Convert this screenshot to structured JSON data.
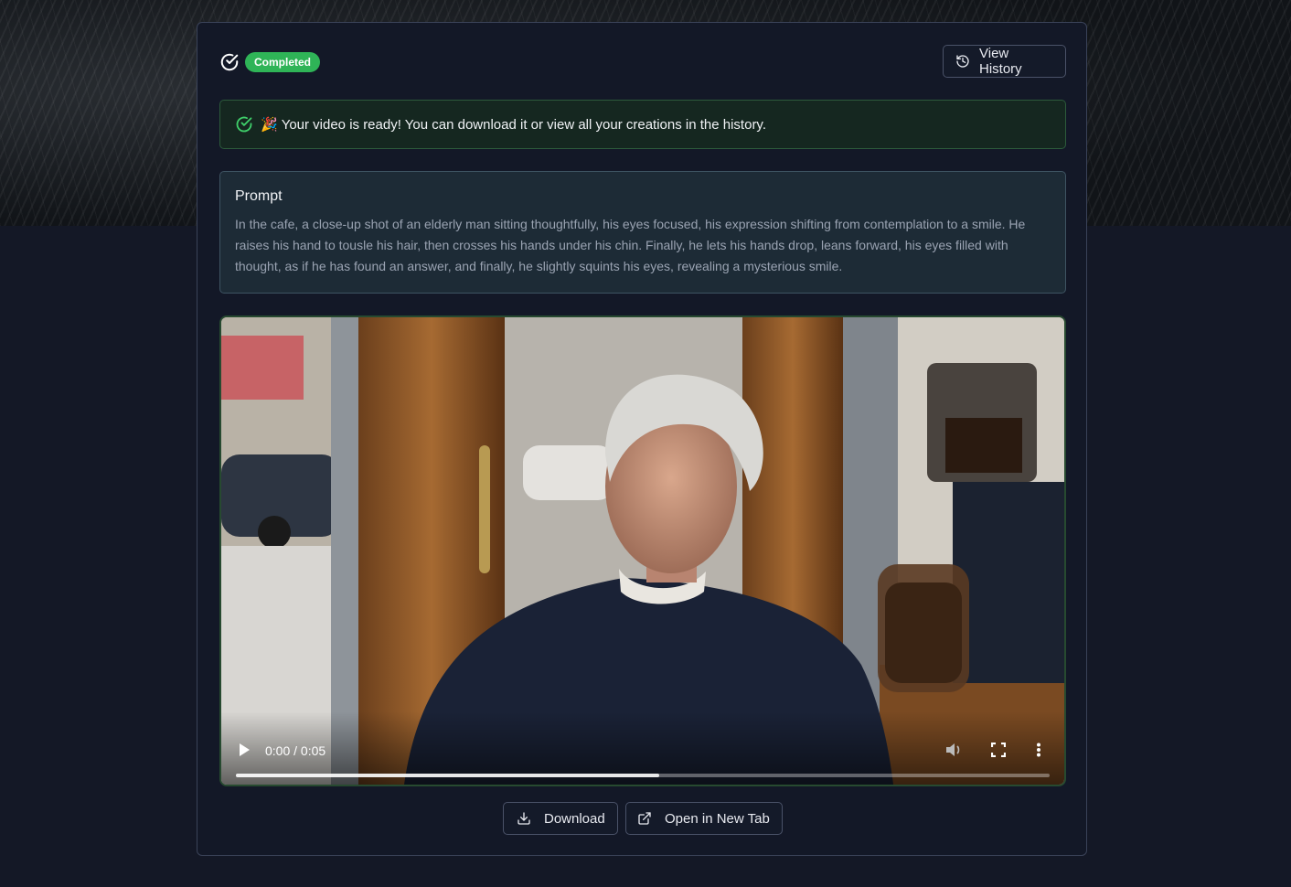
{
  "status": {
    "badge": "Completed",
    "icon": "check-circle-icon",
    "color": "#2fb457"
  },
  "header": {
    "history_label": "View History",
    "history_icon": "history-icon"
  },
  "alert": {
    "icon": "check-circle-icon",
    "emoji": "🎉",
    "message": "Your video is ready! You can download it or view all your creations in the history."
  },
  "prompt": {
    "title": "Prompt",
    "text": "In the cafe, a close-up shot of an elderly man sitting thoughtfully, his eyes focused, his expression shifting from contemplation to a smile. He raises his hand to tousle his hair, then crosses his hands under his chin. Finally, he lets his hands drop, leans forward, his eyes filled with thought, as if he has found an answer, and finally, he slightly squints his eyes, revealing a mysterious smile."
  },
  "video": {
    "time": "0:00 / 0:05",
    "progress": 0.52,
    "icons": [
      "play-icon",
      "volume-icon",
      "fullscreen-icon",
      "more-options-icon"
    ]
  },
  "actions": {
    "download_label": "Download",
    "download_icon": "download-icon",
    "newtab_label": "Open in New Tab",
    "newtab_icon": "external-link-icon"
  }
}
